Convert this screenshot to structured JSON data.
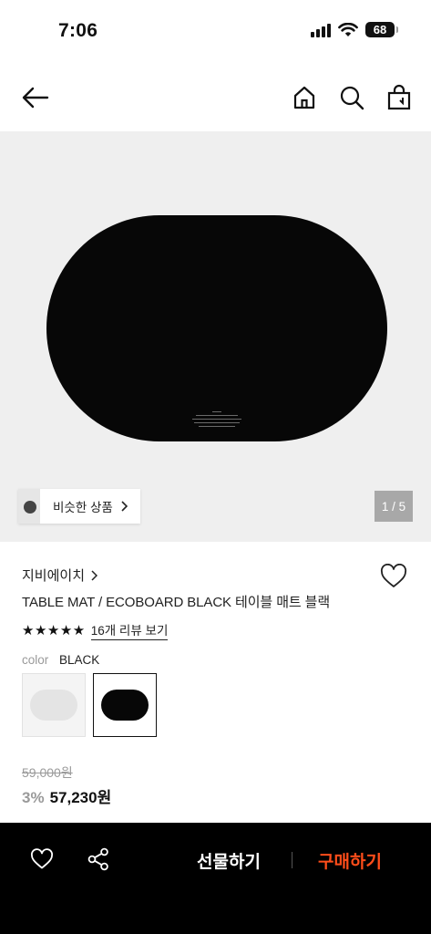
{
  "status": {
    "time": "7:06",
    "battery": "68"
  },
  "nav": {
    "back_icon": "arrow-left-icon",
    "home_icon": "home-icon",
    "search_icon": "search-icon",
    "bag_icon": "shopping-bag-icon"
  },
  "gallery": {
    "similar_label": "비슷한 상품",
    "page_indicator": "1 / 5"
  },
  "product": {
    "brand": "지비에이치",
    "title": "TABLE MAT / ECOBOARD BLACK 테이블 매트 블랙",
    "stars": "★★★★★",
    "review_link": "16개 리뷰 보기",
    "color_label": "color",
    "color_value": "BLACK",
    "original_price": "59,000원",
    "discount": "3%",
    "price": "57,230원"
  },
  "bottom_bar": {
    "gift_label": "선물하기",
    "buy_label": "구매하기"
  },
  "colors": {
    "accent": "#ff4d1a",
    "hero_bg": "#efefef",
    "mat": "#070707"
  }
}
